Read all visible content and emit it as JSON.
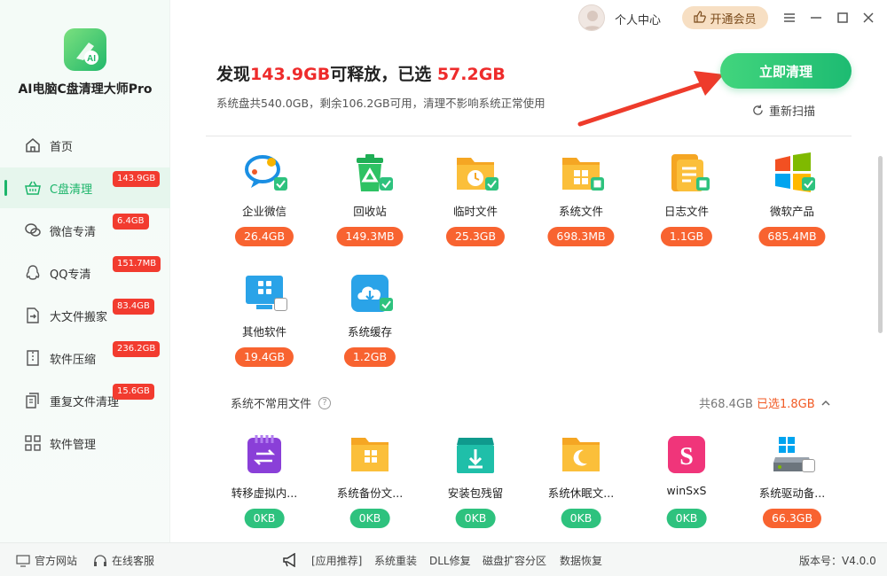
{
  "app": {
    "name": "AI电脑C盘清理大师Pro",
    "version_label": "版本号：V4.0.0"
  },
  "topbar": {
    "user_label": "个人中心",
    "vip_label": "开通会员"
  },
  "sidebar": {
    "items": [
      {
        "label": "首页",
        "badge": ""
      },
      {
        "label": "C盘清理",
        "badge": "143.9GB"
      },
      {
        "label": "微信专清",
        "badge": "6.4GB"
      },
      {
        "label": "QQ专清",
        "badge": "151.7MB"
      },
      {
        "label": "大文件搬家",
        "badge": "83.4GB"
      },
      {
        "label": "软件压缩",
        "badge": "236.2GB"
      },
      {
        "label": "重复文件清理",
        "badge": "15.6GB"
      },
      {
        "label": "软件管理",
        "badge": ""
      }
    ]
  },
  "header": {
    "prefix": "发现",
    "found": "143.9GB",
    "middle": "可释放，已选 ",
    "selected": "57.2GB",
    "subline": "系统盘共540.0GB，剩余106.2GB可用，清理不影响系统正常使用",
    "clean_button": "立即清理",
    "rescan": "重新扫描"
  },
  "items": [
    {
      "label": "企业微信",
      "size": "26.4GB",
      "checked": true,
      "icon": "wecom-icon"
    },
    {
      "label": "回收站",
      "size": "149.3MB",
      "checked": true,
      "icon": "recycle-bin-icon"
    },
    {
      "label": "临时文件",
      "size": "25.3GB",
      "checked": true,
      "icon": "temp-folder-icon"
    },
    {
      "label": "系统文件",
      "size": "698.3MB",
      "checked": true,
      "icon": "system-folder-icon"
    },
    {
      "label": "日志文件",
      "size": "1.1GB",
      "checked": true,
      "icon": "log-file-icon"
    },
    {
      "label": "微软产品",
      "size": "685.4MB",
      "checked": true,
      "icon": "windows-logo-icon"
    },
    {
      "label": "其他软件",
      "size": "19.4GB",
      "checked": false,
      "icon": "monitor-apps-icon"
    },
    {
      "label": "系统缓存",
      "size": "1.2GB",
      "checked": true,
      "icon": "cloud-download-icon"
    }
  ],
  "section": {
    "title": "系统不常用文件",
    "total": "共68.4GB",
    "selected": "已选1.8GB",
    "items": [
      {
        "label": "转移虚拟内...",
        "size": "0KB",
        "icon": "virtual-memory-icon"
      },
      {
        "label": "系统备份文...",
        "size": "0KB",
        "icon": "backup-folder-icon"
      },
      {
        "label": "安装包残留",
        "size": "0KB",
        "icon": "installer-box-icon"
      },
      {
        "label": "系统休眠文...",
        "size": "0KB",
        "icon": "hibernate-folder-icon"
      },
      {
        "label": "winSxS",
        "size": "0KB",
        "icon": "winsxs-icon"
      },
      {
        "label": "系统驱动备...",
        "size": "66.3GB",
        "icon": "driver-backup-icon"
      }
    ]
  },
  "footer": {
    "official_site": "官方网站",
    "support": "在线客服",
    "links": [
      "[应用推荐]",
      "系统重装",
      "DLL修复",
      "磁盘扩容分区",
      "数据恢复"
    ]
  },
  "colors": {
    "accent": "#1bb56a",
    "badge_red": "#f23b2f",
    "size_orange": "#f86330",
    "size_green": "#2ec27e",
    "headline_red": "#ee2b2b"
  }
}
